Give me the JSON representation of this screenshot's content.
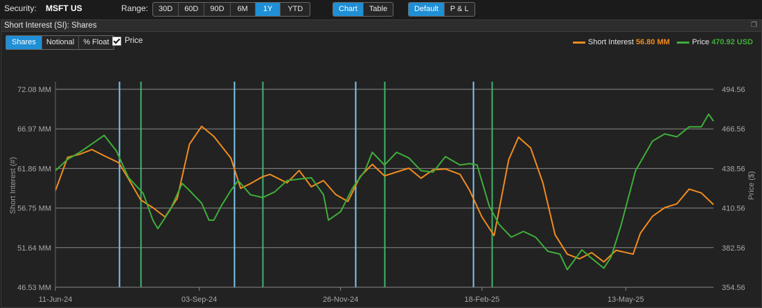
{
  "toolbar": {
    "security_label": "Security:",
    "security_value": "MSFT US",
    "range_label": "Range:",
    "range_options": [
      "30D",
      "60D",
      "90D",
      "6M",
      "1Y",
      "YTD"
    ],
    "range_selected": "1Y",
    "view_options": [
      "Chart",
      "Table"
    ],
    "view_selected": "Chart",
    "mode_options": [
      "Default",
      "P & L"
    ],
    "mode_selected": "Default"
  },
  "panel": {
    "title": "Short Interest (SI): Shares",
    "restore_icon": "restore-icon",
    "metric_options": [
      "Shares",
      "Notional",
      "% Float"
    ],
    "metric_selected": "Shares",
    "price_checkbox_label": "Price",
    "price_checked": true
  },
  "legend": {
    "si_label": "Short Interest",
    "si_value": "56.80 MM",
    "price_label": "Price",
    "price_value": "470.92 USD"
  },
  "colors": {
    "short_interest": "#f28c1e",
    "price": "#3fae3a",
    "vline_blue": "#7ec8f0",
    "vline_green": "#3fb66b",
    "grid": "#8a8a8a",
    "accent": "#1f8fd6"
  },
  "chart_data": {
    "type": "line",
    "xlabel": "",
    "ylabel": "Short Interest (#)",
    "y2label": "Price ($)",
    "x_ticks": [
      "11-Jun-24",
      "03-Sep-24",
      "26-Nov-24",
      "18-Feb-25",
      "13-May-25"
    ],
    "x_tick_index": [
      0,
      59,
      117,
      175,
      234
    ],
    "y_ticks": [
      "72.08 MM",
      "66.97 MM",
      "61.86 MM",
      "56.75 MM",
      "51.64 MM",
      "46.53 MM"
    ],
    "y_values": [
      72.08,
      66.97,
      61.86,
      56.75,
      51.64,
      46.53
    ],
    "ylim": [
      46.53,
      72.08
    ],
    "y2_ticks": [
      "494.56",
      "466.56",
      "438.56",
      "410.56",
      "382.56",
      "354.56"
    ],
    "y2_values": [
      494.56,
      466.56,
      438.56,
      410.56,
      382.56,
      354.56
    ],
    "y2lim": [
      354.56,
      494.56
    ],
    "x_range": [
      0,
      270
    ],
    "grid": true,
    "legend_position": "top-right",
    "vertical_markers": [
      {
        "index": 92,
        "color": "blue"
      },
      {
        "index": 123,
        "color": "green"
      },
      {
        "index": 258,
        "color": "blue"
      },
      {
        "index": 299,
        "color": "green"
      },
      {
        "index": 433,
        "color": "blue"
      },
      {
        "index": 475,
        "color": "green"
      },
      {
        "index": 603,
        "color": "blue"
      },
      {
        "index": 630,
        "color": "green"
      }
    ],
    "series": [
      {
        "name": "Short Interest",
        "axis": "left",
        "x": [
          0,
          5,
          10,
          15,
          20,
          26,
          30,
          35,
          40,
          45,
          50,
          55,
          60,
          65,
          72,
          76,
          80,
          85,
          88,
          95,
          100,
          105,
          110,
          115,
          120,
          125,
          130,
          135,
          140,
          145,
          150,
          155,
          160,
          166,
          170,
          175,
          180,
          186,
          190,
          195,
          200,
          205,
          210,
          215,
          220,
          225,
          230,
          237,
          240,
          245,
          250,
          255,
          260,
          265,
          270
        ],
        "y": [
          59.0,
          63.3,
          63.7,
          64.3,
          63.5,
          62.6,
          60.5,
          57.8,
          56.8,
          55.6,
          58.0,
          65.0,
          67.3,
          66.0,
          63.2,
          59.3,
          59.9,
          60.8,
          61.1,
          60.0,
          61.6,
          59.5,
          60.3,
          58.5,
          57.6,
          60.8,
          62.4,
          60.9,
          61.4,
          61.9,
          60.6,
          61.7,
          61.8,
          61.1,
          59.0,
          55.6,
          53.2,
          63.0,
          65.9,
          64.5,
          60.0,
          53.3,
          50.8,
          50.2,
          51.0,
          49.8,
          51.3,
          50.8,
          53.5,
          55.7,
          56.8,
          57.3,
          59.2,
          58.7,
          57.2
        ]
      },
      {
        "name": "Price",
        "axis": "right",
        "x": [
          0,
          5,
          10,
          15,
          20,
          25,
          30,
          36,
          40,
          42,
          47,
          52,
          55,
          60,
          63,
          65,
          68,
          72,
          75,
          80,
          85,
          90,
          95,
          100,
          105,
          110,
          112,
          117,
          122,
          127,
          130,
          135,
          140,
          145,
          150,
          155,
          160,
          166,
          170,
          173,
          178,
          182,
          187,
          192,
          197,
          202,
          207,
          210,
          216,
          220,
          225,
          228,
          232,
          236,
          238,
          245,
          250,
          255,
          260,
          265,
          268,
          270
        ],
        "y": [
          437,
          445,
          450,
          456,
          462,
          451,
          432,
          421,
          402,
          396,
          409,
          428,
          423,
          414,
          402,
          402,
          412,
          423,
          430,
          420,
          418,
          422,
          430,
          431,
          432,
          420,
          402,
          408,
          425,
          437,
          450,
          441,
          450,
          446,
          437,
          436,
          447,
          441,
          442,
          441,
          412,
          399,
          390,
          394,
          390,
          380,
          378,
          367,
          381,
          375,
          368,
          376,
          398,
          424,
          437,
          458,
          463,
          461,
          468,
          468,
          477,
          472
        ]
      }
    ]
  }
}
